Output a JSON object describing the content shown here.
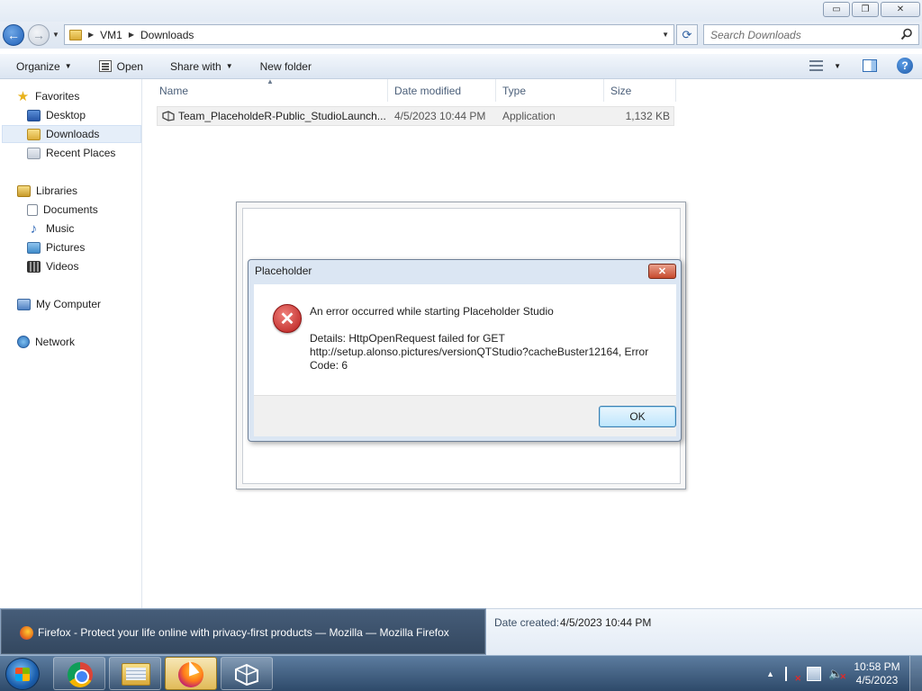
{
  "window": {
    "minimize": "▭",
    "restore": "❐",
    "close": "✕"
  },
  "address": {
    "crumbs": [
      "VM1",
      "Downloads"
    ],
    "search_placeholder": "Search Downloads"
  },
  "toolbar": {
    "organize": "Organize",
    "open": "Open",
    "share_with": "Share with",
    "new_folder": "New folder"
  },
  "nav": {
    "favorites": "Favorites",
    "desktop": "Desktop",
    "downloads": "Downloads",
    "recent_places": "Recent Places",
    "libraries": "Libraries",
    "documents": "Documents",
    "music": "Music",
    "pictures": "Pictures",
    "videos": "Videos",
    "my_computer": "My Computer",
    "network": "Network"
  },
  "columns": {
    "name": "Name",
    "date_modified": "Date modified",
    "type": "Type",
    "size": "Size"
  },
  "files": [
    {
      "name": "Team_PlaceholdeR-Public_StudioLaunch...",
      "date_modified": "4/5/2023 10:44 PM",
      "type": "Application",
      "size": "1,132 KB"
    }
  ],
  "dialog": {
    "title": "Placeholder",
    "message": "An error occurred while starting Placeholder Studio",
    "details_line1": "Details: HttpOpenRequest failed for GET",
    "details_line2": "http://setup.alonso.pictures/versionQTStudio?cacheBuster12164, Error",
    "details_line3": "Code: 6",
    "ok": "OK",
    "close": "✕"
  },
  "details_pane": {
    "label": "Date created:",
    "value": "4/5/2023 10:44 PM"
  },
  "taskbar_preview": {
    "title": "Firefox - Protect your life online with privacy-first products — Mozilla — Mozilla Firefox"
  },
  "clock": {
    "time": "10:58 PM",
    "date": "4/5/2023"
  },
  "colors": {
    "accent": "#2f6db5",
    "error": "#c62828",
    "taskbar": "#3a5677"
  }
}
